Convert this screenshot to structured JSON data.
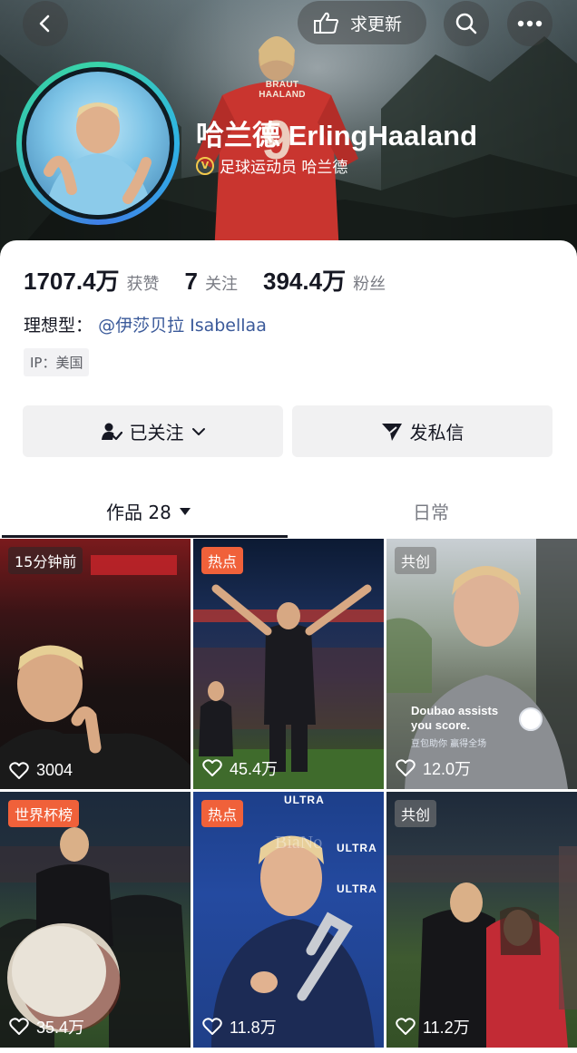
{
  "header": {
    "update_label": "求更新",
    "jersey_name": "BRAUT HAALAND",
    "name": "哈兰德 ErlingHaaland",
    "verified_text": "足球运动员 哈兰德",
    "verified_glyph": "V"
  },
  "stats": [
    {
      "value": "1707.4万",
      "label": "获赞"
    },
    {
      "value": "7",
      "label": "关注"
    },
    {
      "value": "394.4万",
      "label": "粉丝"
    }
  ],
  "profile": {
    "ideal_label": "理想型：",
    "ideal_link": "@伊莎贝拉 Isabellaa",
    "ip": "IP：美国"
  },
  "actions": {
    "follow_label": "已关注",
    "message_label": "发私信"
  },
  "tabs": {
    "works_label": "作品 28",
    "daily_label": "日常"
  },
  "grid": {
    "tiles": [
      {
        "badge": "15分钟前",
        "likes": "3004"
      },
      {
        "badge": "热点",
        "likes": "45.4万"
      },
      {
        "badge": "共创",
        "likes": "12.0万",
        "caption": "Doubao assists you score.",
        "subcaption": "豆包助你 赢得全场"
      },
      {
        "badge": "世界杯榜",
        "likes": "35.4万"
      },
      {
        "badge": "热点",
        "likes": "11.8万",
        "brand": "ULTRA"
      },
      {
        "badge": "共创",
        "likes": "11.2万"
      }
    ]
  },
  "colors": {
    "hot_badge": "#f0613a",
    "link": "#3b5a9a",
    "avatar_ring": "#2fb3e6",
    "verify": "#f2c94c"
  }
}
